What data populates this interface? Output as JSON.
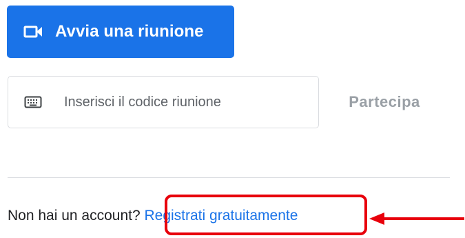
{
  "start_meeting": {
    "label": "Avvia una riunione",
    "icon": "video-camera-icon",
    "color": "#1a73e8"
  },
  "join": {
    "icon": "keyboard-icon",
    "placeholder": "Inserisci il codice riunione",
    "value": "",
    "button_label": "Partecipa"
  },
  "signup": {
    "prompt": "Non hai un account?",
    "link_label": "Registrati gratuitamente"
  },
  "annotation": {
    "highlight_color": "#e8000b"
  }
}
